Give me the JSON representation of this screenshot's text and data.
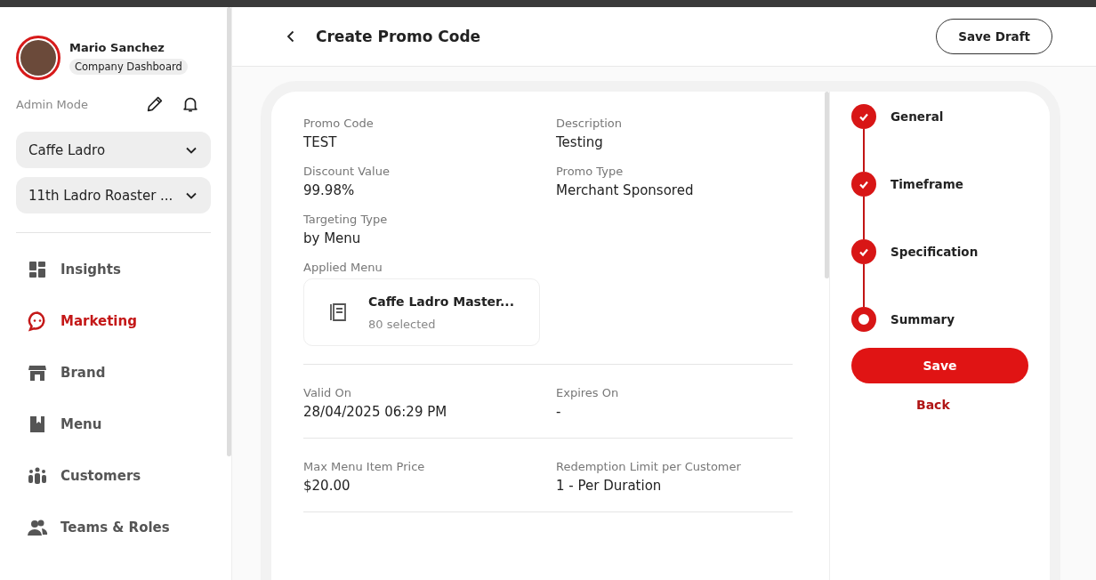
{
  "user": {
    "name": "Mario Sanchez",
    "badge": "Company Dashboard",
    "mode": "Admin Mode"
  },
  "selectors": [
    {
      "value": "Caffe Ladro"
    },
    {
      "value": "11th Ladro Roaster ..."
    }
  ],
  "nav": [
    {
      "label": "Insights",
      "kind": "grid",
      "selected": false
    },
    {
      "label": "Marketing",
      "kind": "chat",
      "selected": true
    },
    {
      "label": "Brand",
      "kind": "store",
      "selected": false
    },
    {
      "label": "Menu",
      "kind": "book",
      "selected": false
    },
    {
      "label": "Customers",
      "kind": "people",
      "selected": false
    },
    {
      "label": "Teams & Roles",
      "kind": "team",
      "selected": false
    }
  ],
  "header": {
    "title": "Create Promo Code",
    "save_draft": "Save Draft"
  },
  "sections": [
    {
      "fields": [
        {
          "label": "Promo Code",
          "value": "TEST"
        },
        {
          "label": "Description",
          "value": "Testing"
        },
        {
          "label": "Discount Value",
          "value": "99.98%"
        },
        {
          "label": "Promo Type",
          "value": "Merchant Sponsored"
        },
        {
          "label": "Targeting Type",
          "value": "by Menu"
        }
      ],
      "applied_menu": {
        "label": "Applied Menu",
        "name": "Caffe Ladro Master...",
        "count": "80 selected"
      }
    },
    {
      "fields": [
        {
          "label": "Valid On",
          "value": "28/04/2025 06:29 PM"
        },
        {
          "label": "Expires On",
          "value": "-"
        }
      ]
    },
    {
      "fields": [
        {
          "label": "Max Menu Item Price",
          "value": "$20.00"
        },
        {
          "label": "Redemption Limit per Customer",
          "value": "1 - Per Duration"
        }
      ]
    }
  ],
  "steps": [
    {
      "label": "General",
      "completed": true
    },
    {
      "label": "Timeframe",
      "completed": true
    },
    {
      "label": "Specification",
      "completed": true
    },
    {
      "label": "Summary",
      "completed": false
    }
  ],
  "actions": {
    "save": "Save",
    "back": "Back"
  }
}
